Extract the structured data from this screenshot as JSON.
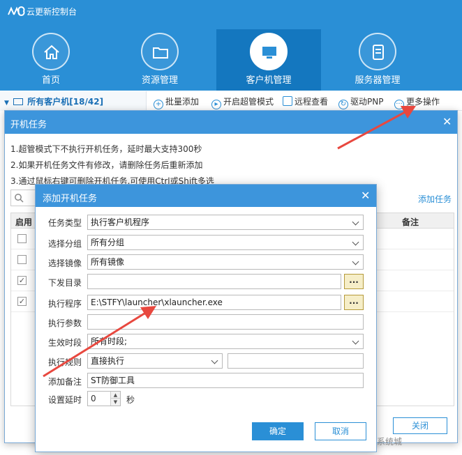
{
  "app": {
    "logo_text": "ᗢᗢ",
    "title": "云更新控制台"
  },
  "nav": [
    {
      "label": "首页",
      "icon": "home-icon"
    },
    {
      "label": "资源管理",
      "icon": "folder-icon"
    },
    {
      "label": "客户机管理",
      "icon": "monitor-icon",
      "active": true
    },
    {
      "label": "服务器管理",
      "icon": "server-icon"
    }
  ],
  "tree": {
    "title": "所有客户机[18/42]"
  },
  "toolbar": {
    "batch_add": "批量添加",
    "super_mode": "开启超管模式",
    "remote_view": "远程查看",
    "driver_pnp": "驱动PNP",
    "more_ops": "更多操作"
  },
  "startup_dialog": {
    "title": "开机任务",
    "notes": [
      "1.超管模式下不执行开机任务，延时最大支持300秒",
      "2.如果开机任务文件有修改，请删除任务后重新添加",
      "3.通过鼠标右键可删除开机任务,可使用Ctrl或Shift多选"
    ],
    "add_task": "添加任务",
    "columns": {
      "enable": "启用",
      "remark": "备注"
    },
    "close_button": "关闭"
  },
  "add_dialog": {
    "title": "添加开机任务",
    "task_type_label": "任务类型",
    "task_type_value": "执行客户机程序",
    "group_label": "选择分组",
    "group_value": "所有分组",
    "image_label": "选择镜像",
    "image_value": "所有镜像",
    "dir_label": "下发目录",
    "dir_value": "",
    "program_label": "执行程序",
    "program_value": "E:\\STFY\\launcher\\xlauncher.exe",
    "params_label": "执行参数",
    "params_value": "",
    "period_label": "生效时段",
    "period_value": "所有时段;",
    "rule_label": "执行规则",
    "rule_value": "直接执行",
    "rule_extra_value": "",
    "remark_label": "添加备注",
    "remark_value": "ST防御工具",
    "delay_label": "设置延时",
    "delay_value": "0",
    "delay_unit": "秒",
    "browse_label": "...",
    "ok": "确定",
    "cancel": "取消"
  },
  "watermark": "系统城"
}
